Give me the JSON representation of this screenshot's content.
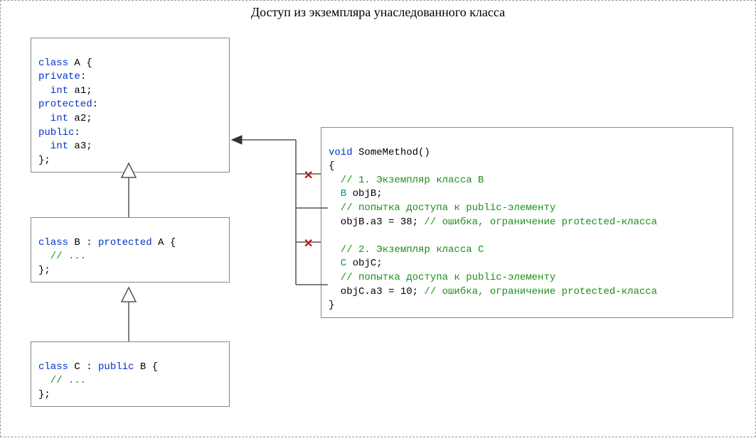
{
  "title": "Доступ из экземпляра унаследованного класса",
  "classA": {
    "line1_kw": "class",
    "line1_name": " A {",
    "line2_kw": "private",
    "line2_rest": ":",
    "line3_kw": "  int",
    "line3_rest": " a1;",
    "line4_kw": "protected",
    "line4_rest": ":",
    "line5_kw": "  int",
    "line5_rest": " a2;",
    "line6_kw": "public",
    "line6_rest": ":",
    "line7_kw": "  int",
    "line7_rest": " a3;",
    "line8": "};"
  },
  "classB": {
    "line1_kw": "class",
    "line1_name": " B : ",
    "line1_mod": "protected",
    "line1_base": " A {",
    "line2_cmt": "  // ...",
    "line3": "};"
  },
  "classC": {
    "line1_kw": "class",
    "line1_name": " C : ",
    "line1_mod": "public",
    "line1_base": " B {",
    "line2_cmt": "  // ...",
    "line3": "};"
  },
  "method": {
    "l1_kw": "void",
    "l1_rest": " SomeMethod()",
    "l2": "{",
    "l3_cmt": "  // 1. Экземпляр класса B",
    "l4_cls": "  B",
    "l4_rest": " objB;",
    "l5_cmt": "  // попытка доступа к public-элементу",
    "l6_a": "  objB.a3 = 38; ",
    "l6_cmt": "// ошибка, ограничение protected-класса",
    "l7": "",
    "l8_cmt": "  // 2. Экземпляр класса C",
    "l9_cls": "  C",
    "l9_rest": " objC;",
    "l10_cmt": "  // попытка доступа к public-элементу",
    "l11_a": "  objC.a3 = 10; ",
    "l11_cmt": "// ошибка, ограничение protected-класса",
    "l12": "}"
  },
  "marks": {
    "x1": "✕",
    "x2": "✕"
  }
}
